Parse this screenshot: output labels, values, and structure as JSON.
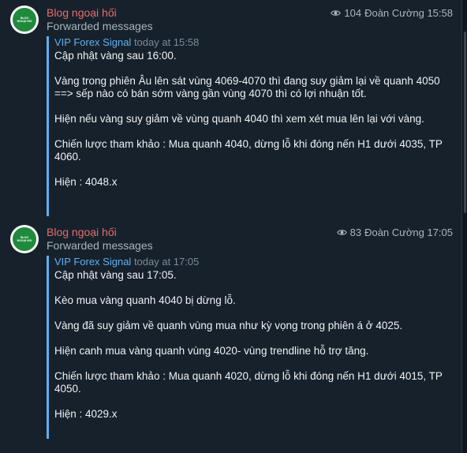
{
  "messages": [
    {
      "sender": "Blog ngoại hối",
      "forwarded_label": "Forwarded messages",
      "views": "104",
      "author_time": "Đoàn Cường 15:58",
      "avatar_line1": "BLOG",
      "avatar_line2": "NGOẠI HỐI",
      "source": "VIP Forex Signal",
      "source_time": "today at 15:58",
      "text": "Cập nhật vàng sau 16:00.\n\nVàng trong phiên Âu lên sát vùng 4069-4070 thì đang suy giảm lại về quanh 4050 ==> sếp nào có bán sớm vàng gần vùng 4070 thì có lợi nhuận tốt.\n\nHiện nếu vàng suy giảm về vùng quanh 4040 thì xem xét mua lên lại với vàng.\n\nChiến lược tham khảo : Mua quanh 4040, dừng lỗ khi đóng nến H1 dưới 4035, TP 4060.\n\nHiện : 4048.x"
    },
    {
      "sender": "Blog ngoại hối",
      "forwarded_label": "Forwarded messages",
      "views": "83",
      "author_time": "Đoàn Cường 17:05",
      "avatar_line1": "BLOG",
      "avatar_line2": "NGOẠI HỐI",
      "source": "VIP Forex Signal",
      "source_time": "today at 17:05",
      "text": "Cập nhật vàng sau 17:05.\n\nKèo mua vàng quanh 4040 bị dừng lỗ.\n\nVàng đã suy giảm về quanh vùng mua như kỳ vọng trong phiên á ở 4025.\n\nHiện canh mua vàng quanh vùng 4020- vùng trendline hỗ trợ tăng.\n\nChiến lược tham khảo : Mua quanh 4020, dừng lỗ khi đóng nến H1 dưới 4015, TP 4050.\n\nHiện : 4029.x"
    }
  ],
  "colors": {
    "background": "#17212b",
    "sender": "#e46d6d",
    "link": "#5fb1f2",
    "accent_bar": "#62aef0"
  },
  "icons": {
    "views": "eye-icon"
  }
}
